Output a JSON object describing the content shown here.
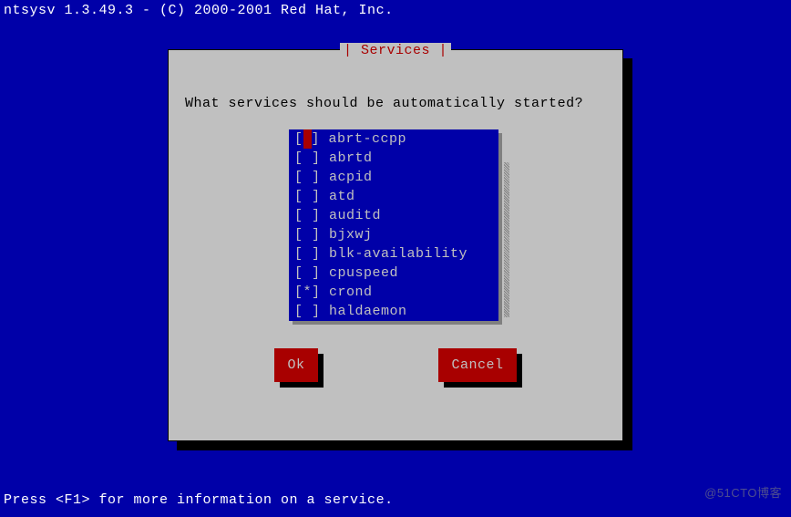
{
  "header_line": "ntsysv 1.3.49.3 - (C) 2000-2001 Red Hat, Inc.",
  "dialog": {
    "title": "| Services |",
    "prompt": "What services should be automatically started?",
    "services": [
      {
        "mark": "cursor",
        "name": "abrt-ccpp"
      },
      {
        "mark": " ",
        "name": "abrtd"
      },
      {
        "mark": " ",
        "name": "acpid"
      },
      {
        "mark": " ",
        "name": "atd"
      },
      {
        "mark": " ",
        "name": "auditd"
      },
      {
        "mark": " ",
        "name": "bjxwj"
      },
      {
        "mark": " ",
        "name": "blk-availability"
      },
      {
        "mark": " ",
        "name": "cpuspeed"
      },
      {
        "mark": "*",
        "name": "crond"
      },
      {
        "mark": " ",
        "name": "haldaemon"
      }
    ],
    "ok_label": "Ok",
    "cancel_label": "Cancel"
  },
  "footer_line": "Press <F1> for more information on a service.",
  "watermark": "@51CTO博客"
}
